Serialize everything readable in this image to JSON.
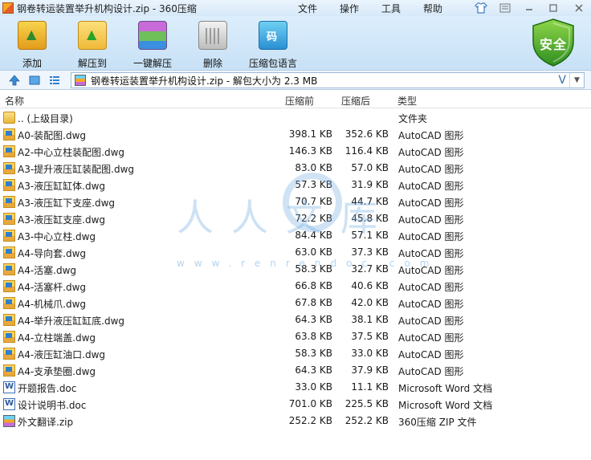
{
  "window": {
    "title": "钢卷转运装置举升机构设计.zip - 360压缩"
  },
  "menu": [
    "文件",
    "操作",
    "工具",
    "帮助"
  ],
  "toolbar": {
    "add": "添加",
    "extract": "解压到",
    "one_click": "一键解压",
    "delete": "删除",
    "lang": "压缩包语言"
  },
  "security_badge": "安全",
  "address": {
    "path": "钢卷转运装置举升机构设计.zip - 解包大小为 2.3 MB",
    "dropdown": "V"
  },
  "columns": {
    "name": "名称",
    "size": "压缩前",
    "packed": "压缩后",
    "type": "类型"
  },
  "files": [
    {
      "name": ".. (上级目录)",
      "size": "",
      "packed": "",
      "type": "文件夹",
      "icon": "folder-icon"
    },
    {
      "name": "A0-装配图.dwg",
      "size": "398.1 KB",
      "packed": "352.6 KB",
      "type": "AutoCAD 图形",
      "icon": "dwg-icon"
    },
    {
      "name": "A2-中心立柱装配图.dwg",
      "size": "146.3 KB",
      "packed": "116.4 KB",
      "type": "AutoCAD 图形",
      "icon": "dwg-icon"
    },
    {
      "name": "A3-提升液压缸装配图.dwg",
      "size": "83.0 KB",
      "packed": "57.0 KB",
      "type": "AutoCAD 图形",
      "icon": "dwg-icon"
    },
    {
      "name": "A3-液压缸缸体.dwg",
      "size": "57.3 KB",
      "packed": "31.9 KB",
      "type": "AutoCAD 图形",
      "icon": "dwg-icon"
    },
    {
      "name": "A3-液压缸下支座.dwg",
      "size": "70.7 KB",
      "packed": "44.7 KB",
      "type": "AutoCAD 图形",
      "icon": "dwg-icon"
    },
    {
      "name": "A3-液压缸支座.dwg",
      "size": "72.2 KB",
      "packed": "45.8 KB",
      "type": "AutoCAD 图形",
      "icon": "dwg-icon"
    },
    {
      "name": "A3-中心立柱.dwg",
      "size": "84.4 KB",
      "packed": "57.1 KB",
      "type": "AutoCAD 图形",
      "icon": "dwg-icon"
    },
    {
      "name": "A4-导向套.dwg",
      "size": "63.0 KB",
      "packed": "37.3 KB",
      "type": "AutoCAD 图形",
      "icon": "dwg-icon"
    },
    {
      "name": "A4-活塞.dwg",
      "size": "58.3 KB",
      "packed": "32.7 KB",
      "type": "AutoCAD 图形",
      "icon": "dwg-icon"
    },
    {
      "name": "A4-活塞杆.dwg",
      "size": "66.8 KB",
      "packed": "40.6 KB",
      "type": "AutoCAD 图形",
      "icon": "dwg-icon"
    },
    {
      "name": "A4-机械爪.dwg",
      "size": "67.8 KB",
      "packed": "42.0 KB",
      "type": "AutoCAD 图形",
      "icon": "dwg-icon"
    },
    {
      "name": "A4-举升液压缸缸底.dwg",
      "size": "64.3 KB",
      "packed": "38.1 KB",
      "type": "AutoCAD 图形",
      "icon": "dwg-icon"
    },
    {
      "name": "A4-立柱端盖.dwg",
      "size": "63.8 KB",
      "packed": "37.5 KB",
      "type": "AutoCAD 图形",
      "icon": "dwg-icon"
    },
    {
      "name": "A4-液压缸油口.dwg",
      "size": "58.3 KB",
      "packed": "33.0 KB",
      "type": "AutoCAD 图形",
      "icon": "dwg-icon"
    },
    {
      "name": "A4-支承垫圈.dwg",
      "size": "64.3 KB",
      "packed": "37.9 KB",
      "type": "AutoCAD 图形",
      "icon": "dwg-icon"
    },
    {
      "name": "开题报告.doc",
      "size": "33.0 KB",
      "packed": "11.1 KB",
      "type": "Microsoft Word 文档",
      "icon": "word-doc-icon"
    },
    {
      "name": "设计说明书.doc",
      "size": "701.0 KB",
      "packed": "225.5 KB",
      "type": "Microsoft Word 文档",
      "icon": "word-doc-icon"
    },
    {
      "name": "外文翻译.zip",
      "size": "252.2 KB",
      "packed": "252.2 KB",
      "type": "360压缩 ZIP 文件",
      "icon": "zip-archive-icon"
    }
  ],
  "watermark": {
    "text": "人人文库",
    "url": "www.renrendoc.com"
  }
}
